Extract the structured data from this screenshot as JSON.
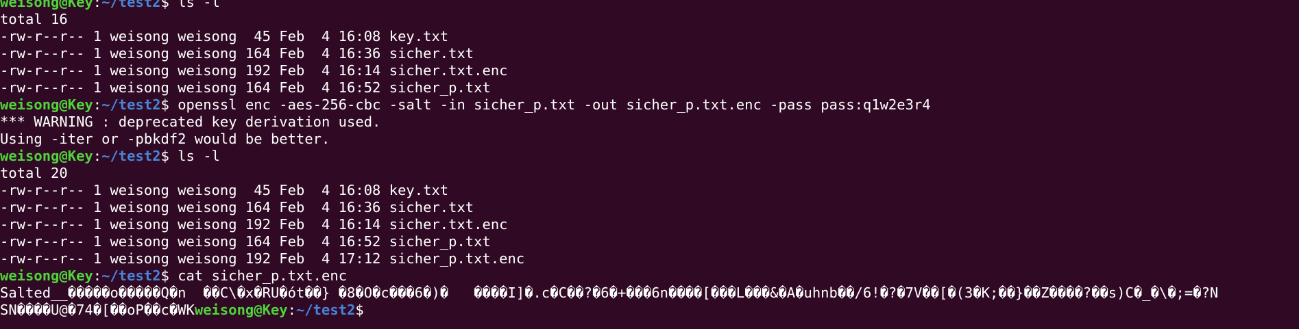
{
  "colors": {
    "background": "#300a24",
    "text": "#ffffff",
    "user_host": "#4fd43a",
    "path": "#4a84d8"
  },
  "prompt": {
    "user_host": "weisong@Key",
    "colon": ":",
    "path": "~/test2",
    "dollar": "$ "
  },
  "lines": [
    {
      "type": "prompt",
      "command": "ls -l"
    },
    {
      "type": "output",
      "text": "total 16"
    },
    {
      "type": "output",
      "text": "-rw-r--r-- 1 weisong weisong  45 Feb  4 16:08 key.txt"
    },
    {
      "type": "output",
      "text": "-rw-r--r-- 1 weisong weisong 164 Feb  4 16:36 sicher.txt"
    },
    {
      "type": "output",
      "text": "-rw-r--r-- 1 weisong weisong 192 Feb  4 16:14 sicher.txt.enc"
    },
    {
      "type": "output",
      "text": "-rw-r--r-- 1 weisong weisong 164 Feb  4 16:52 sicher_p.txt"
    },
    {
      "type": "prompt",
      "command": "openssl enc -aes-256-cbc -salt -in sicher_p.txt -out sicher_p.txt.enc -pass pass:q1w2e3r4"
    },
    {
      "type": "output",
      "text": "*** WARNING : deprecated key derivation used."
    },
    {
      "type": "output",
      "text": "Using -iter or -pbkdf2 would be better."
    },
    {
      "type": "prompt",
      "command": "ls -l"
    },
    {
      "type": "output",
      "text": "total 20"
    },
    {
      "type": "output",
      "text": "-rw-r--r-- 1 weisong weisong  45 Feb  4 16:08 key.txt"
    },
    {
      "type": "output",
      "text": "-rw-r--r-- 1 weisong weisong 164 Feb  4 16:36 sicher.txt"
    },
    {
      "type": "output",
      "text": "-rw-r--r-- 1 weisong weisong 192 Feb  4 16:14 sicher.txt.enc"
    },
    {
      "type": "output",
      "text": "-rw-r--r-- 1 weisong weisong 164 Feb  4 16:52 sicher_p.txt"
    },
    {
      "type": "output",
      "text": "-rw-r--r-- 1 weisong weisong 192 Feb  4 17:12 sicher_p.txt.enc"
    },
    {
      "type": "prompt",
      "command": "cat sicher_p.txt.enc"
    },
    {
      "type": "output",
      "text": "Salted__�����o�����Q�n  ��C\\�x�RU�ót��} �8�O�c���6�)�   ����I]�.c�C��?�6�+���6n����[���L���&�A�uhnb��/6!�?�7V��[�(3�K;��}��Z����?��s)C�_�\\�;=�?N"
    },
    {
      "type": "prompt_tail",
      "prefix": "SN����U@�74�[��oP��c�WK",
      "command": ""
    }
  ]
}
